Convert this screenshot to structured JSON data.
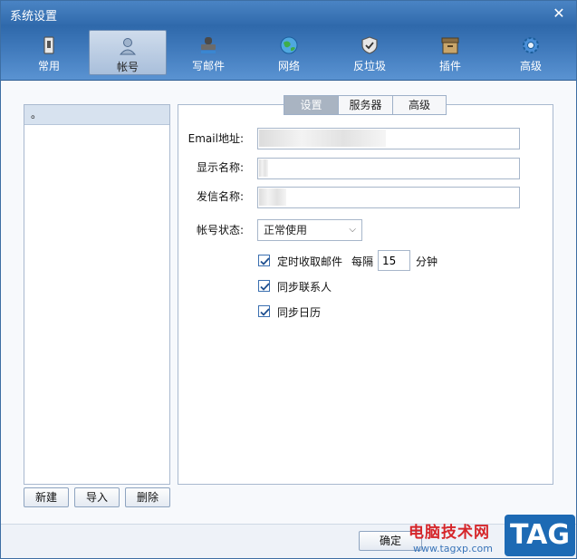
{
  "window": {
    "title": "系统设置",
    "close_glyph": "✕"
  },
  "toolbar": {
    "items": [
      {
        "label": "常用",
        "icon": "phone-icon"
      },
      {
        "label": "帐号",
        "icon": "user-icon",
        "active": true
      },
      {
        "label": "写邮件",
        "icon": "stamp-icon"
      },
      {
        "label": "网络",
        "icon": "globe-icon"
      },
      {
        "label": "反垃圾",
        "icon": "shield-icon"
      },
      {
        "label": "插件",
        "icon": "box-icon"
      },
      {
        "label": "高级",
        "icon": "gear-icon"
      }
    ]
  },
  "accounts": {
    "items": [
      "。"
    ]
  },
  "account_buttons": {
    "new": "新建",
    "import": "导入",
    "delete": "删除"
  },
  "tabs": {
    "items": [
      "设置",
      "服务器",
      "高级"
    ],
    "active": 0
  },
  "form": {
    "email_label": "Email地址:",
    "email_value": "",
    "display_name_label": "显示名称:",
    "display_name_value": "",
    "sender_name_label": "发信名称:",
    "sender_name_value": "",
    "status_label": "帐号状态:",
    "status_value": "正常使用"
  },
  "options": {
    "auto_receive_label": "定时收取邮件",
    "auto_receive_checked": true,
    "every_label": "每隔",
    "interval_value": "15",
    "minutes_label": "分钟",
    "sync_contacts_label": "同步联系人",
    "sync_contacts_checked": true,
    "sync_calendar_label": "同步日历",
    "sync_calendar_checked": true
  },
  "footer": {
    "ok_label": "确定"
  },
  "watermark": {
    "site_name": "电脑技术网",
    "url": "www.tagxp.com",
    "logo": "TAG"
  },
  "colors": {
    "title_bar": "#3a74b6",
    "accent": "#3b6fb0",
    "watermark_red": "#d6262a"
  }
}
